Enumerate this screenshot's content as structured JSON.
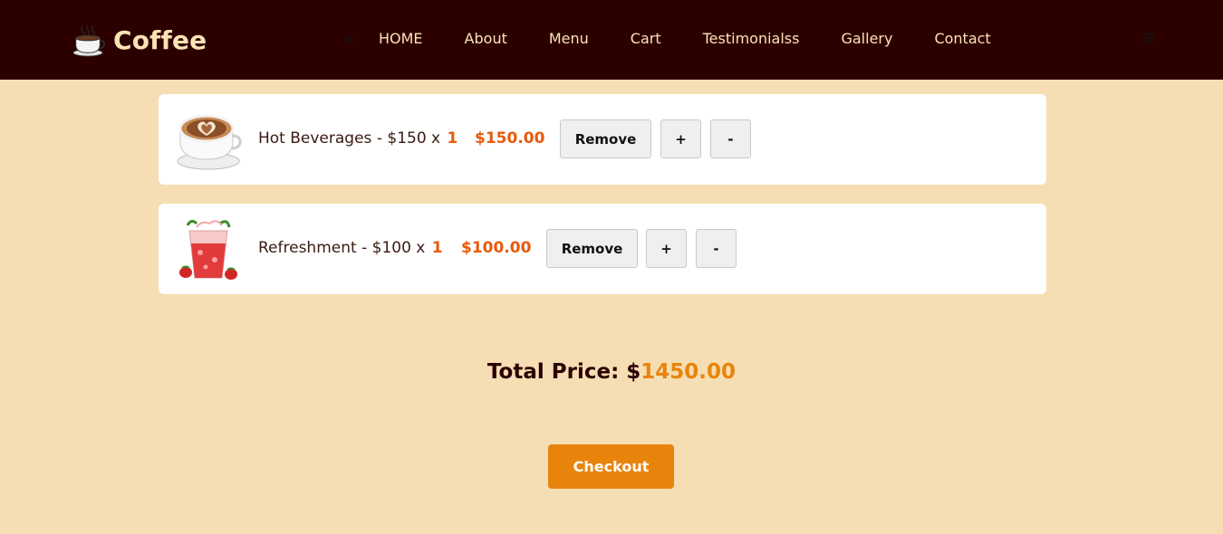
{
  "brand": {
    "name": "Coffee",
    "icon": "coffee-cup-icon"
  },
  "nav": {
    "close_icon": "close-icon",
    "close_symbol": "×",
    "links": [
      "HOME",
      "About",
      "Menu",
      "Cart",
      "Testimonialss",
      "Gallery",
      "Contact"
    ],
    "menu_icon": "hamburger-icon"
  },
  "cart": {
    "items": [
      {
        "name": "Hot Beverages",
        "unit_price": "$150",
        "quantity": "1",
        "line_total": "$150.00",
        "image_icon": "latte-art-cup-icon",
        "remove_label": "Remove",
        "plus_label": "+",
        "minus_label": "-"
      },
      {
        "name": "Refreshment",
        "unit_price": "$100",
        "quantity": "1",
        "line_total": "$100.00",
        "image_icon": "strawberry-drink-icon",
        "remove_label": "Remove",
        "plus_label": "+",
        "minus_label": "-"
      }
    ],
    "total_label": "Total Price: $",
    "total_amount": "1450.00",
    "checkout_label": "Checkout"
  },
  "colors": {
    "navbar_bg": "#2d0000",
    "page_bg": "#f5deb3",
    "accent_orange": "#e8840c",
    "price_red_orange": "#e8590c",
    "nav_text": "#fbe3b5"
  }
}
